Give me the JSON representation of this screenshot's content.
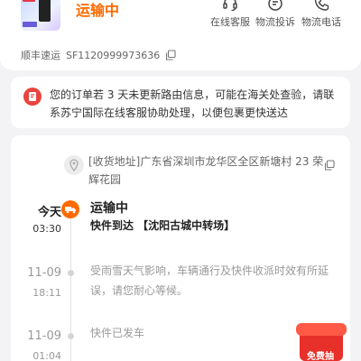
{
  "status": {
    "title": "运输中",
    "title_color": "#ff6a00"
  },
  "shortcuts": [
    {
      "label": "在线客服",
      "icon": "headset-icon"
    },
    {
      "label": "物流投诉",
      "icon": "complaint-icon"
    },
    {
      "label": "物流电话",
      "icon": "phone-icon"
    }
  ],
  "tracking": {
    "carrier": "顺丰速运",
    "number": "SF1120999973636",
    "copy_icon": "copy-icon"
  },
  "notice": {
    "icon": "receipt-alert-icon",
    "text": "您的订单若 3 天未更新路由信息，可能在海关处查验，请联系苏宁国际在线客服协助处理，以便包裹更快送达",
    "accent": "#e8443f"
  },
  "address": {
    "icon": "location-pin-icon",
    "text": "[收货地址]广东省深圳市龙华区全区新塘村 23 荣辉花园"
  },
  "timeline": [
    {
      "date": "今天",
      "time": "03:30",
      "status": "运输中",
      "detail": "快件到达 【沈阳古城中转场】",
      "current": true
    },
    {
      "date": "11-09",
      "time": "18:11",
      "text": "受雨雪天气影响，车辆通行及快件收派时效有所延误，请您耐心等候。"
    },
    {
      "date": "11-09",
      "time": "01:04",
      "text": "快件已发车"
    }
  ],
  "promo": {
    "label": "免费抽",
    "icon": "gift-box-icon"
  }
}
